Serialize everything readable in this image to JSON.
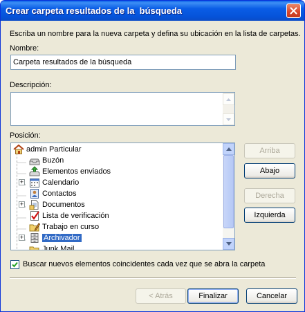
{
  "window": {
    "title": "Crear carpeta resultados de la  búsqueda"
  },
  "intro_text": "Escriba un nombre para la nueva carpeta y defina su ubicación en la lista de carpetas.",
  "name": {
    "label": "Nombre:",
    "value": "Carpeta resultados de la búsqueda"
  },
  "description": {
    "label": "Descripción:",
    "value": ""
  },
  "position": {
    "label": "Posición:",
    "tree": [
      {
        "label": "admin Particular",
        "icon": "home-icon"
      },
      {
        "label": "Buzón",
        "icon": "inbox-icon"
      },
      {
        "label": "Elementos enviados",
        "icon": "sent-items-icon"
      },
      {
        "label": "Calendario",
        "icon": "calendar-icon"
      },
      {
        "label": "Contactos",
        "icon": "contacts-icon"
      },
      {
        "label": "Documentos",
        "icon": "documents-icon"
      },
      {
        "label": "Lista de verificación",
        "icon": "checklist-icon"
      },
      {
        "label": "Trabajo en curso",
        "icon": "work-in-progress-icon"
      },
      {
        "label": "Archivador",
        "icon": "cabinet-icon",
        "selected": true
      },
      {
        "label": "Junk Mail",
        "icon": "junk-mail-icon"
      }
    ]
  },
  "buttons": {
    "up": "Arriba",
    "down": "Abajo",
    "right": "Derecha",
    "left": "Izquierda",
    "back": "< Atrás",
    "finish": "Finalizar",
    "cancel": "Cancelar"
  },
  "checkbox": {
    "label": "Buscar nuevos elementos coincidentes cada vez que se abra la carpeta",
    "checked": true
  },
  "colors": {
    "titlebar": "#0553d9",
    "selection": "#316ac5",
    "dialog_bg": "#ece9d8"
  }
}
